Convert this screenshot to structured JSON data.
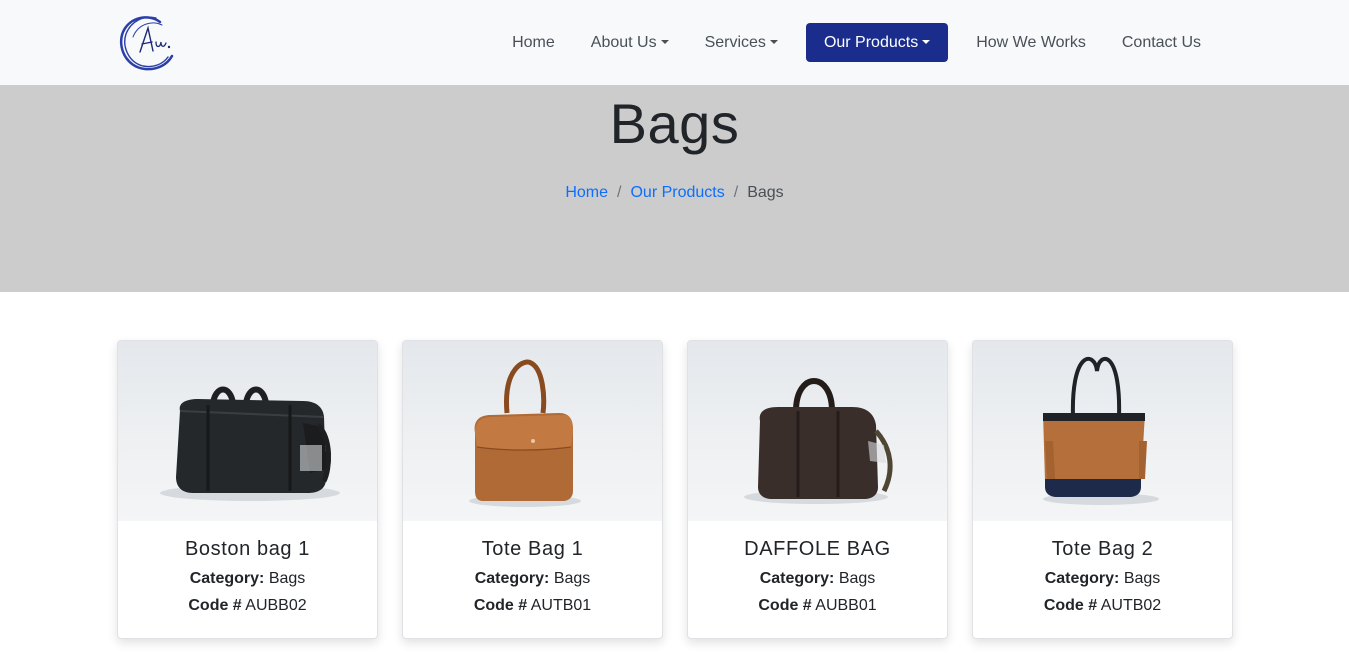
{
  "nav": {
    "items": [
      {
        "label": "Home",
        "dropdown": false,
        "active": false
      },
      {
        "label": "About Us",
        "dropdown": true,
        "active": false
      },
      {
        "label": "Services",
        "dropdown": true,
        "active": false
      },
      {
        "label": "Our Products",
        "dropdown": true,
        "active": true
      },
      {
        "label": "How We Works",
        "dropdown": false,
        "active": false
      },
      {
        "label": "Contact Us",
        "dropdown": false,
        "active": false
      }
    ],
    "active_color": "#1a2d8c"
  },
  "hero": {
    "title": "Bags",
    "breadcrumb": {
      "home": "Home",
      "products": "Our Products",
      "current": "Bags",
      "separator": "/"
    }
  },
  "labels": {
    "category": "Category:",
    "code": "Code #"
  },
  "products": [
    {
      "name": "Boston bag 1",
      "category": "Bags",
      "code": "AUBB02"
    },
    {
      "name": "Tote Bag 1",
      "category": "Bags",
      "code": "AUTB01"
    },
    {
      "name": "DAFFOLE BAG",
      "category": "Bags",
      "code": "AUBB01"
    },
    {
      "name": "Tote Bag 2",
      "category": "Bags",
      "code": "AUTB02"
    }
  ]
}
